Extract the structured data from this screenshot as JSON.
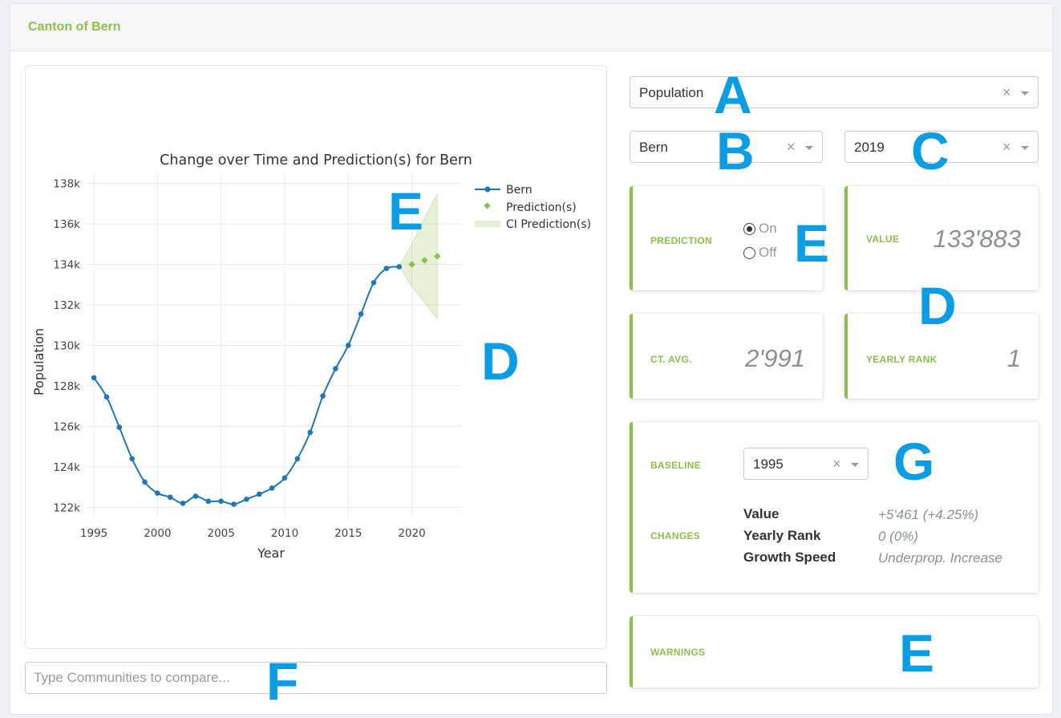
{
  "header": {
    "title": "Canton of Bern"
  },
  "chart_data": {
    "type": "line",
    "title": "Change over Time and Prediction(s) for Bern",
    "xlabel": "Year",
    "ylabel": "Population",
    "xlim": [
      1994.3,
      2024
    ],
    "ylim": [
      121500,
      138500
    ],
    "x_ticks": [
      1995,
      2000,
      2005,
      2010,
      2015,
      2020
    ],
    "x_tick_labels": [
      "1995",
      "2000",
      "2005",
      "2010",
      "2015",
      "2020"
    ],
    "y_ticks": [
      122000,
      124000,
      126000,
      128000,
      130000,
      132000,
      134000,
      136000,
      138000
    ],
    "y_tick_labels": [
      "122k",
      "124k",
      "126k",
      "128k",
      "130k",
      "132k",
      "134k",
      "136k",
      "138k"
    ],
    "grid": true,
    "legend_position": "top-right",
    "series": [
      {
        "name": "Bern",
        "kind": "line+markers",
        "color": "#1f77b4",
        "x": [
          1995,
          1996,
          1997,
          1998,
          1999,
          2000,
          2001,
          2002,
          2003,
          2004,
          2005,
          2006,
          2007,
          2008,
          2009,
          2010,
          2011,
          2012,
          2013,
          2014,
          2015,
          2016,
          2017,
          2018,
          2019
        ],
        "y": [
          128400,
          127450,
          125950,
          124400,
          123250,
          122700,
          122500,
          122200,
          122550,
          122300,
          122300,
          122150,
          122400,
          122650,
          122950,
          123450,
          124400,
          125700,
          127500,
          128850,
          130000,
          131550,
          133100,
          133800,
          133883
        ]
      },
      {
        "name": "Prediction(s)",
        "kind": "markers",
        "color": "#8dc04a",
        "x": [
          2020,
          2021,
          2022
        ],
        "y": [
          134000,
          134200,
          134400
        ]
      },
      {
        "name": "CI Prediction(s)",
        "kind": "band",
        "color": "#8dc04a",
        "x": [
          2019,
          2020,
          2021,
          2022
        ],
        "lower": [
          133883,
          132900,
          132100,
          131300
        ],
        "upper": [
          133883,
          135000,
          136300,
          137500
        ]
      }
    ]
  },
  "compare": {
    "placeholder": "Type Communities to compare..."
  },
  "selects": {
    "indicator": {
      "value": "Population",
      "clear": "×"
    },
    "community": {
      "value": "Bern",
      "clear": "×"
    },
    "year": {
      "value": "2019",
      "clear": "×"
    },
    "baseline": {
      "value": "1995",
      "clear": "×"
    }
  },
  "prediction": {
    "label": "PREDICTION",
    "options": [
      {
        "label": "On",
        "checked": true
      },
      {
        "label": "Off",
        "checked": false
      }
    ]
  },
  "value_card": {
    "label": "VALUE",
    "value": "133'883"
  },
  "avg_card": {
    "label": "CT. AVG.",
    "value": "2'991"
  },
  "rank_card": {
    "label": "YEARLY RANK",
    "value": "1"
  },
  "baseline_card": {
    "label": "BASELINE",
    "changes_label": "CHANGES",
    "rows": [
      {
        "key": "Value",
        "value": "+5'461 (+4.25%)"
      },
      {
        "key": "Yearly Rank",
        "value": "0 (0%)"
      },
      {
        "key": "Growth Speed",
        "value": "Underprop. Increase"
      }
    ]
  },
  "warnings_card": {
    "label": "WARNINGS"
  },
  "annotations": {
    "a": "A",
    "b": "B",
    "c": "C",
    "d_chart": "D",
    "d_value": "D",
    "e_chart": "E",
    "e_prediction": "E",
    "e_warnings": "E",
    "f": "F",
    "g": "G"
  },
  "colors": {
    "accent": "#8dc04a",
    "series": "#1f77b4",
    "annotation": "#0a9ce5"
  }
}
